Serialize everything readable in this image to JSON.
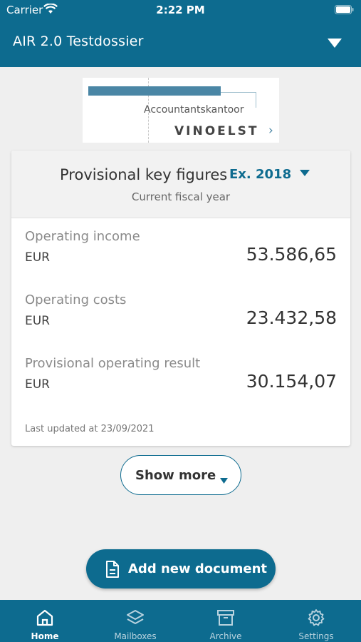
{
  "status_bar": {
    "carrier": "Carrier",
    "time": "2:22 PM"
  },
  "header": {
    "title": "AIR 2.0 Testdossier",
    "dropdown_icon": "caret-down-icon"
  },
  "logo": {
    "line1": "Accountantskantoor",
    "line2": "VINOELST",
    "chevron": "›"
  },
  "key_figures": {
    "title": "Provisional key figures",
    "year": "Ex. 2018",
    "subtitle": "Current fiscal year",
    "rows": [
      {
        "label": "Operating income",
        "currency": "EUR",
        "value": "53.586,65"
      },
      {
        "label": "Operating costs",
        "currency": "EUR",
        "value": "23.432,58"
      },
      {
        "label": "Provisional operating result",
        "currency": "EUR",
        "value": "30.154,07"
      }
    ],
    "updated": "Last updated at 23/09/2021"
  },
  "show_more": {
    "label": "Show more"
  },
  "add_document": {
    "label": "Add new document",
    "icon": "document-icon"
  },
  "tabs": [
    {
      "label": "Home",
      "icon": "home-icon",
      "active": true
    },
    {
      "label": "Mailboxes",
      "icon": "layers-icon",
      "active": false
    },
    {
      "label": "Archive",
      "icon": "archive-icon",
      "active": false
    },
    {
      "label": "Settings",
      "icon": "gear-icon",
      "active": false
    }
  ],
  "colors": {
    "brand": "#0d6b8f",
    "background": "#efefef",
    "logo_accent": "#4a86a5"
  }
}
